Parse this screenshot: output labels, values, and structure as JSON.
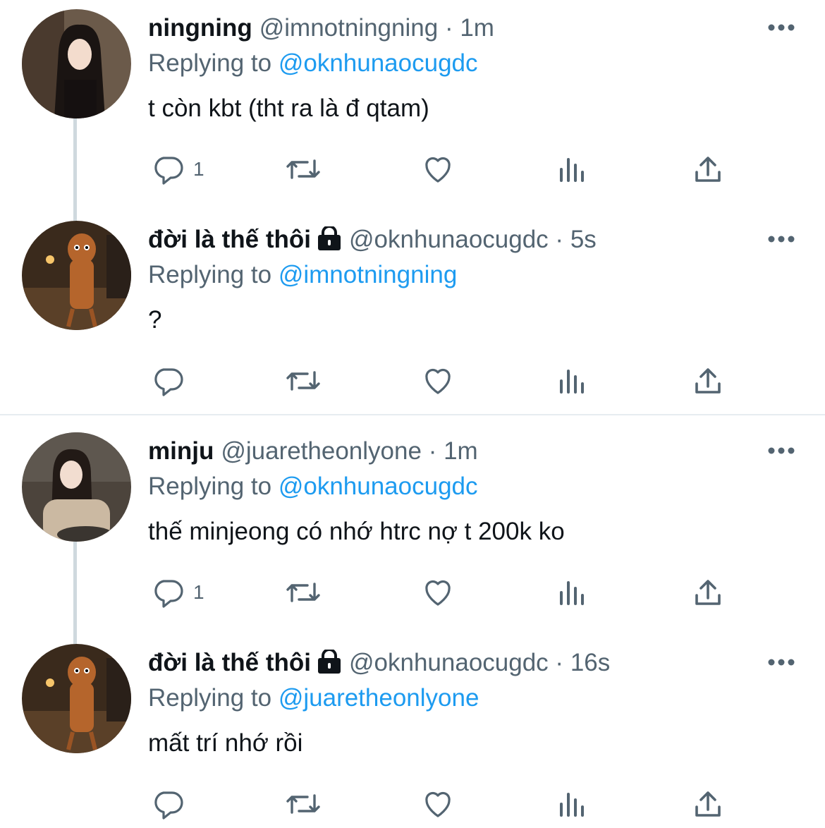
{
  "tweets": [
    {
      "name": "ningning",
      "handle": "@imnotningning",
      "time": "1m",
      "replying_prefix": "Replying to ",
      "replying_to": "@oknhunaocugdc",
      "text": "t còn kbt (tht ra là đ qtam)",
      "reply_count": "1",
      "locked": false,
      "avatar_icon": "avatar-photo"
    },
    {
      "name": "đời là thế thôi",
      "handle": "@oknhunaocugdc",
      "time": "5s",
      "replying_prefix": "Replying to ",
      "replying_to": "@imnotningning",
      "text": "?",
      "reply_count": "",
      "locked": true,
      "avatar_icon": "avatar-photo"
    },
    {
      "name": "minju",
      "handle": "@juaretheonlyone",
      "time": "1m",
      "replying_prefix": "Replying to ",
      "replying_to": "@oknhunaocugdc",
      "text": "thế minjeong có nhớ htrc nợ t 200k ko",
      "reply_count": "1",
      "locked": false,
      "avatar_icon": "avatar-photo"
    },
    {
      "name": "đời là thế thôi",
      "handle": "@oknhunaocugdc",
      "time": "16s",
      "replying_prefix": "Replying to ",
      "replying_to": "@juaretheonlyone",
      "text": "mất trí nhớ rồi",
      "reply_count": "",
      "locked": true,
      "avatar_icon": "avatar-photo"
    }
  ],
  "separator": "·",
  "colors": {
    "text": "#0f1419",
    "secondary": "#536471",
    "link": "#1d9bf0",
    "thread_line": "#cfd9de",
    "divider": "#e6ecf0"
  }
}
